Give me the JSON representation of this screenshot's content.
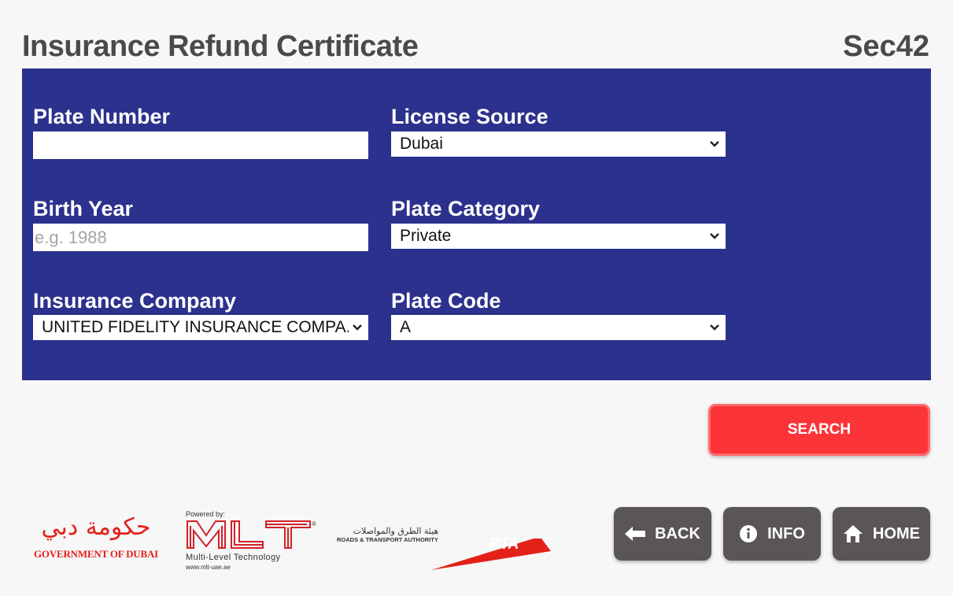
{
  "header": {
    "title": "Insurance Refund Certificate",
    "screen_code": "Sec42"
  },
  "form": {
    "plate_number": {
      "label": "Plate Number",
      "value": ""
    },
    "license_source": {
      "label": "License Source",
      "value": "Dubai"
    },
    "birth_year": {
      "label": "Birth Year",
      "value": "",
      "placeholder": "e.g. 1988"
    },
    "plate_category": {
      "label": "Plate Category",
      "value": "Private"
    },
    "insurance_company": {
      "label": "Insurance Company",
      "value": "UNITED FIDELITY INSURANCE COMPA..."
    },
    "plate_code": {
      "label": "Plate Code",
      "value": "A"
    }
  },
  "actions": {
    "search_label": "SEARCH"
  },
  "nav": {
    "back_label": "BACK",
    "info_label": "INFO",
    "home_label": "HOME"
  },
  "footer": {
    "dubai_gov": {
      "arabic": "حكومة دبي",
      "english": "GOVERNMENT OF DUBAI"
    },
    "mlt": {
      "powered_by": "Powered by:",
      "name": "MLT",
      "tagline": "Multi-Level Technology",
      "url": "www.mlt-uae.ae"
    },
    "rta": {
      "arabic": "هيئة الطرق والمواصلات",
      "english": "ROADS & TRANSPORT AUTHORITY",
      "abbr": "RTA"
    }
  },
  "colors": {
    "panel": "#2b318c",
    "accent_red": "#fb3438",
    "nav_button": "#5a5655",
    "title_text": "#4a4a4a",
    "brand_red": "#e32119"
  }
}
